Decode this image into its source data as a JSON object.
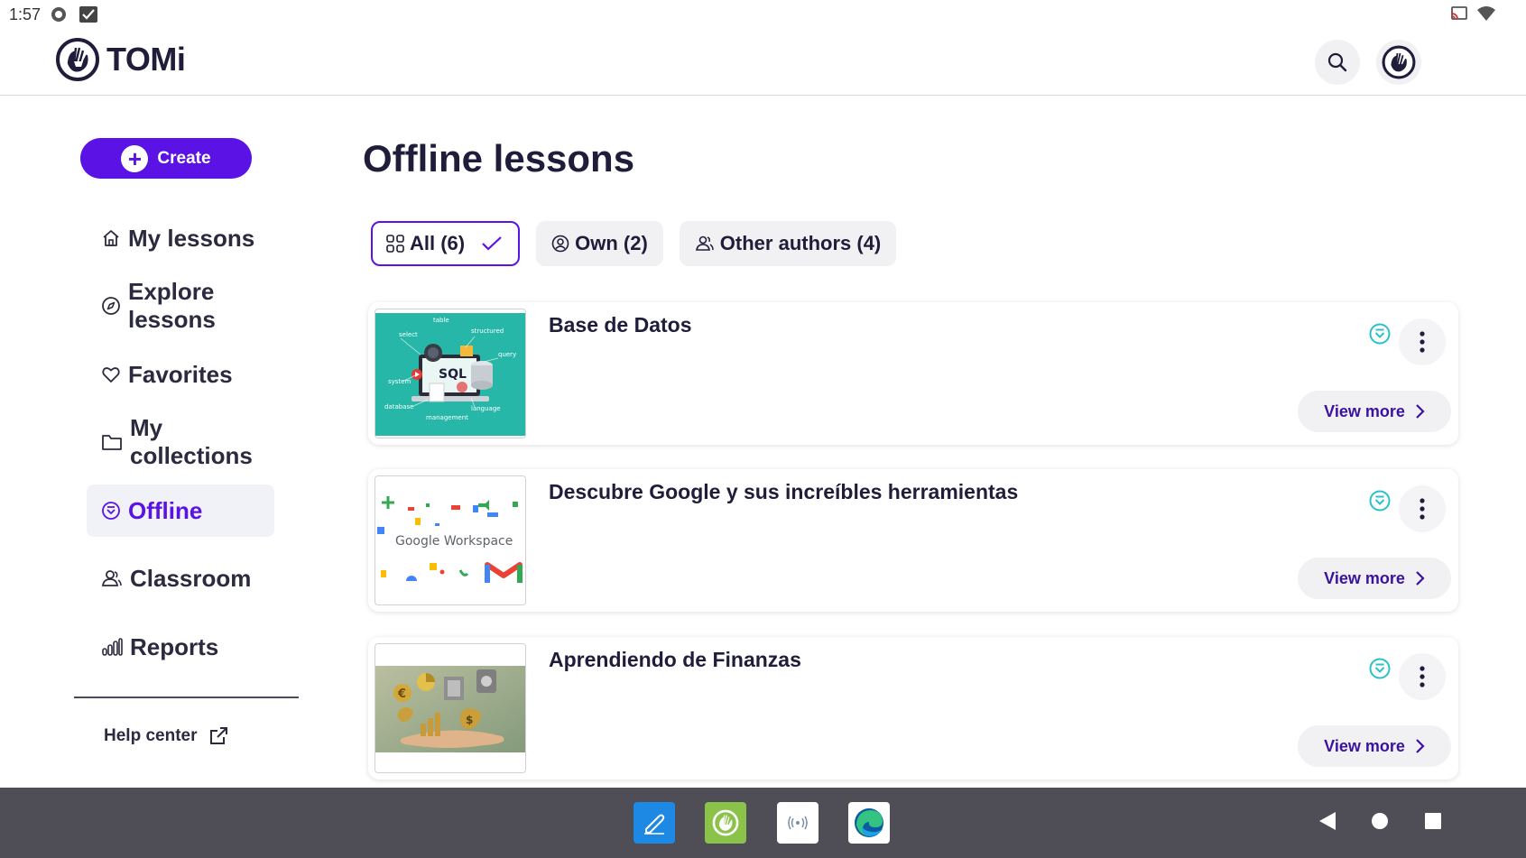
{
  "status_bar": {
    "time": "1:57"
  },
  "brand": {
    "name": "TOMi"
  },
  "sidebar": {
    "create_label": "Create",
    "items": [
      {
        "label": "My lessons",
        "icon": "home-icon"
      },
      {
        "label": "Explore lessons",
        "icon": "compass-icon"
      },
      {
        "label": "Favorites",
        "icon": "heart-icon"
      },
      {
        "label": "My collections",
        "icon": "folder-icon"
      },
      {
        "label": "Offline",
        "icon": "offline-icon",
        "active": true
      },
      {
        "label": "Classroom",
        "icon": "people-icon"
      },
      {
        "label": "Reports",
        "icon": "bar-chart-icon"
      }
    ],
    "help_label": "Help center"
  },
  "main": {
    "title": "Offline lessons",
    "filters": [
      {
        "label": "All (6)",
        "active": true
      },
      {
        "label": "Own (2)",
        "active": false
      },
      {
        "label": "Other authors (4)",
        "active": false
      }
    ],
    "lessons": [
      {
        "title": "Base de Datos",
        "view_more": "View more"
      },
      {
        "title": "Descubre Google y sus increíbles herramientas",
        "view_more": "View more"
      },
      {
        "title": "Aprendiendo de Finanzas",
        "view_more": "View more"
      }
    ],
    "thumbs": {
      "db_words": [
        "table",
        "select",
        "structured",
        "query",
        "SQL",
        "system",
        "database",
        "language",
        "management"
      ],
      "workspace_text": "Google Workspace"
    }
  },
  "colors": {
    "accent": "#5b12e5",
    "offline_teal": "#2cc0c7",
    "navbar_bg": "#4f4d55"
  }
}
